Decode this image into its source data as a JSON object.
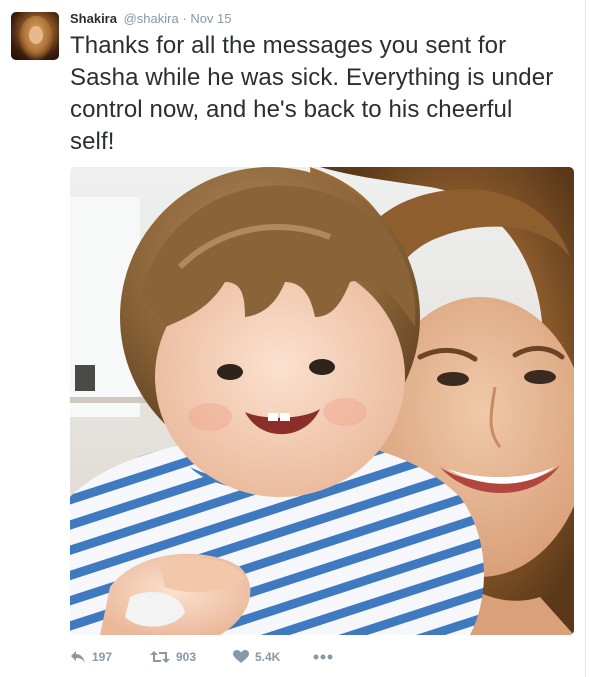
{
  "tweet": {
    "author_name": "Shakira",
    "author_handle": "@shakira",
    "separator": "·",
    "date": "Nov 15",
    "text": "Thanks for all the messages you sent for Sasha while he was sick. Everything is under control now, and he's back to his cheerful self!",
    "photo_alt": "Photo of Shakira smiling with her young son Sasha, who wears a blue and white striped shirt"
  },
  "actions": {
    "reply_count": "197",
    "retweet_count": "903",
    "like_count": "5.4K"
  },
  "icons": {
    "reply": "reply-icon",
    "retweet": "retweet-icon",
    "like": "heart-icon",
    "more": "more-dots-icon"
  },
  "colors": {
    "text": "#292f33",
    "muted": "#8899a6",
    "border": "#e1e8ed"
  }
}
